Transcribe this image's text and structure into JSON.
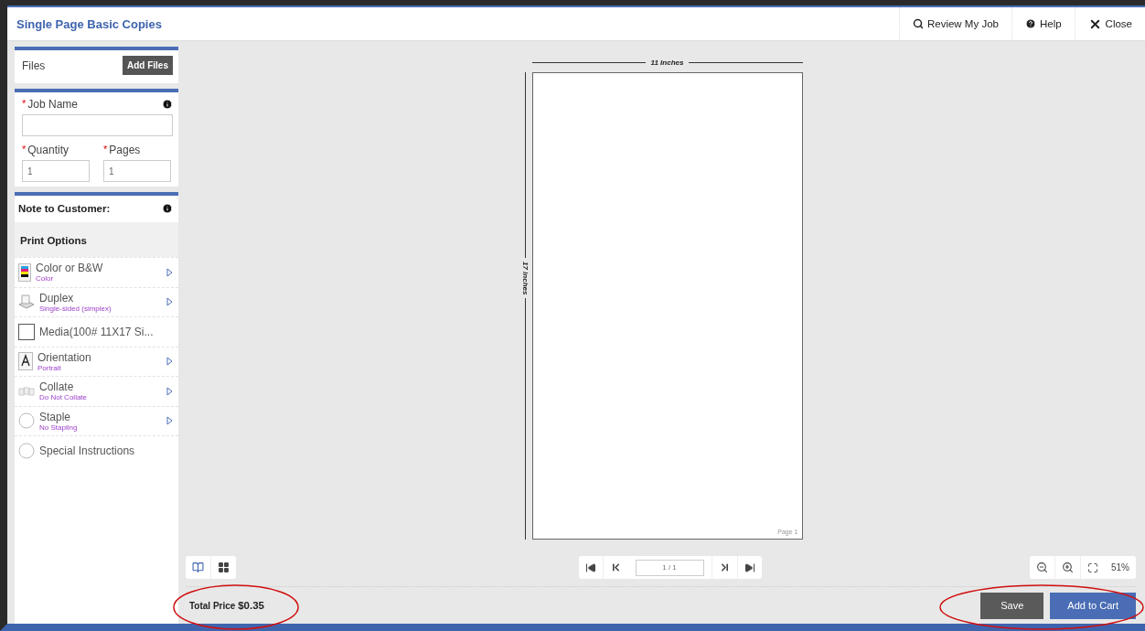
{
  "window": {
    "title": "Single Page Basic Copies"
  },
  "header_actions": [
    {
      "kind": "search",
      "label": "Review My Job"
    },
    {
      "kind": "help",
      "label": "Help"
    },
    {
      "kind": "close",
      "label": "Close"
    }
  ],
  "files": {
    "label": "Files",
    "button": "Add Files"
  },
  "job": {
    "name": {
      "mark": "*",
      "label": "Job Name"
    },
    "quantity": {
      "mark": "*",
      "label": "Quantity",
      "value": "1"
    },
    "pages": {
      "mark": "*",
      "label": "Pages",
      "value": "1"
    }
  },
  "note": {
    "label": "Note to Customer:"
  },
  "print_options": {
    "title": "Print Options",
    "items": [
      {
        "kind": "color",
        "label": "Color or B&W",
        "value": "Color",
        "expandable": true
      },
      {
        "kind": "duplex",
        "label": "Duplex",
        "value": "Single-sided (simplex)",
        "expandable": true
      },
      {
        "kind": "checkbox",
        "label": "Media(100# 11X17 Si...",
        "checked": false,
        "expandable": false
      },
      {
        "kind": "orientation",
        "label": "Orientation",
        "value": "Portrait",
        "expandable": true
      },
      {
        "kind": "collate",
        "label": "Collate",
        "value": "Do Not Collate",
        "expandable": true
      },
      {
        "kind": "radio",
        "label": "Staple",
        "value": "No Stapling",
        "checked": false,
        "expandable": true
      },
      {
        "kind": "radio",
        "label": "Special Instructions",
        "checked": false,
        "expandable": false
      }
    ]
  },
  "preview": {
    "width_label": "11 Inches",
    "height_label": "17 Inches",
    "page_label": "Page 1"
  },
  "view_modes": [
    {
      "kind": "single",
      "selected": true
    },
    {
      "kind": "grid",
      "selected": false
    }
  ],
  "pager": {
    "value": "1 / 1"
  },
  "zoom": {
    "value": "51%"
  },
  "footer": {
    "total_label": "Total Price",
    "total_value": "$0.35",
    "buttons": [
      {
        "kind": "secondary",
        "label": "Save"
      },
      {
        "kind": "primary",
        "label": "Add to Cart"
      }
    ]
  },
  "annotations": [
    {
      "kind": "ellipse"
    },
    {
      "kind": "ellipse"
    }
  ]
}
